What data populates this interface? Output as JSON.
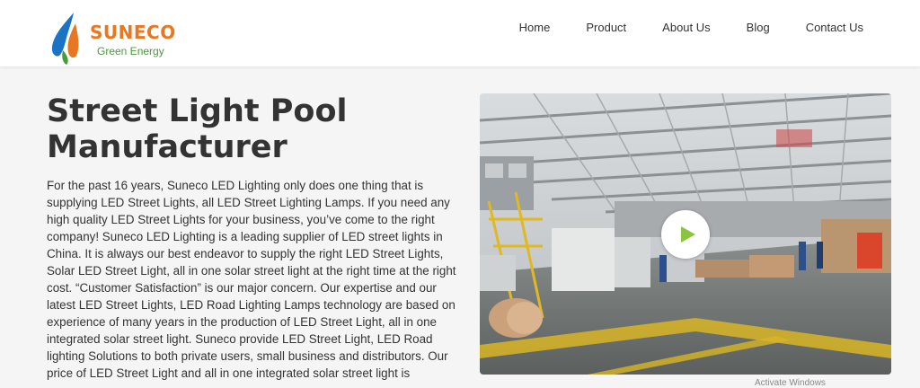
{
  "brand": {
    "name": "SUNECO",
    "tagline": "Green Energy",
    "colors": {
      "orange": "#e87722",
      "blue": "#1a73c4",
      "green": "#4a9a3a"
    }
  },
  "nav": {
    "items": [
      {
        "label": "Home"
      },
      {
        "label": "Product"
      },
      {
        "label": "About Us"
      },
      {
        "label": "Blog"
      },
      {
        "label": "Contact Us"
      }
    ]
  },
  "main": {
    "title": "Street Light Pool Manufacturer",
    "body": "For the past 16 years, Suneco LED Lighting only does one thing that is supplying LED Street Lights, all LED Street Lighting Lamps.  If you need any high quality LED Street Lights for your business, you’ve come to the right company!  Suneco LED Lighting is a leading supplier of LED street lights in China.  It is always our best endeavor to supply the right LED Street Lights, Solar LED Street Light, all in one solar street light at the right time at the right cost.  “Customer Satisfaction” is our major concern.  Our expertise and our latest LED Street Lights, LED Road Lighting Lamps technology are based on experience of many years in the production of LED Street Light, all in one integrated solar street light.  Suneco provide LED Street Light, LED Road lighting Solutions to both private users, small business and distributors. Our price of LED Street Light and all in one integrated solar street light is"
  },
  "video": {
    "icon": "play-icon",
    "caption": "Activate Windows"
  }
}
